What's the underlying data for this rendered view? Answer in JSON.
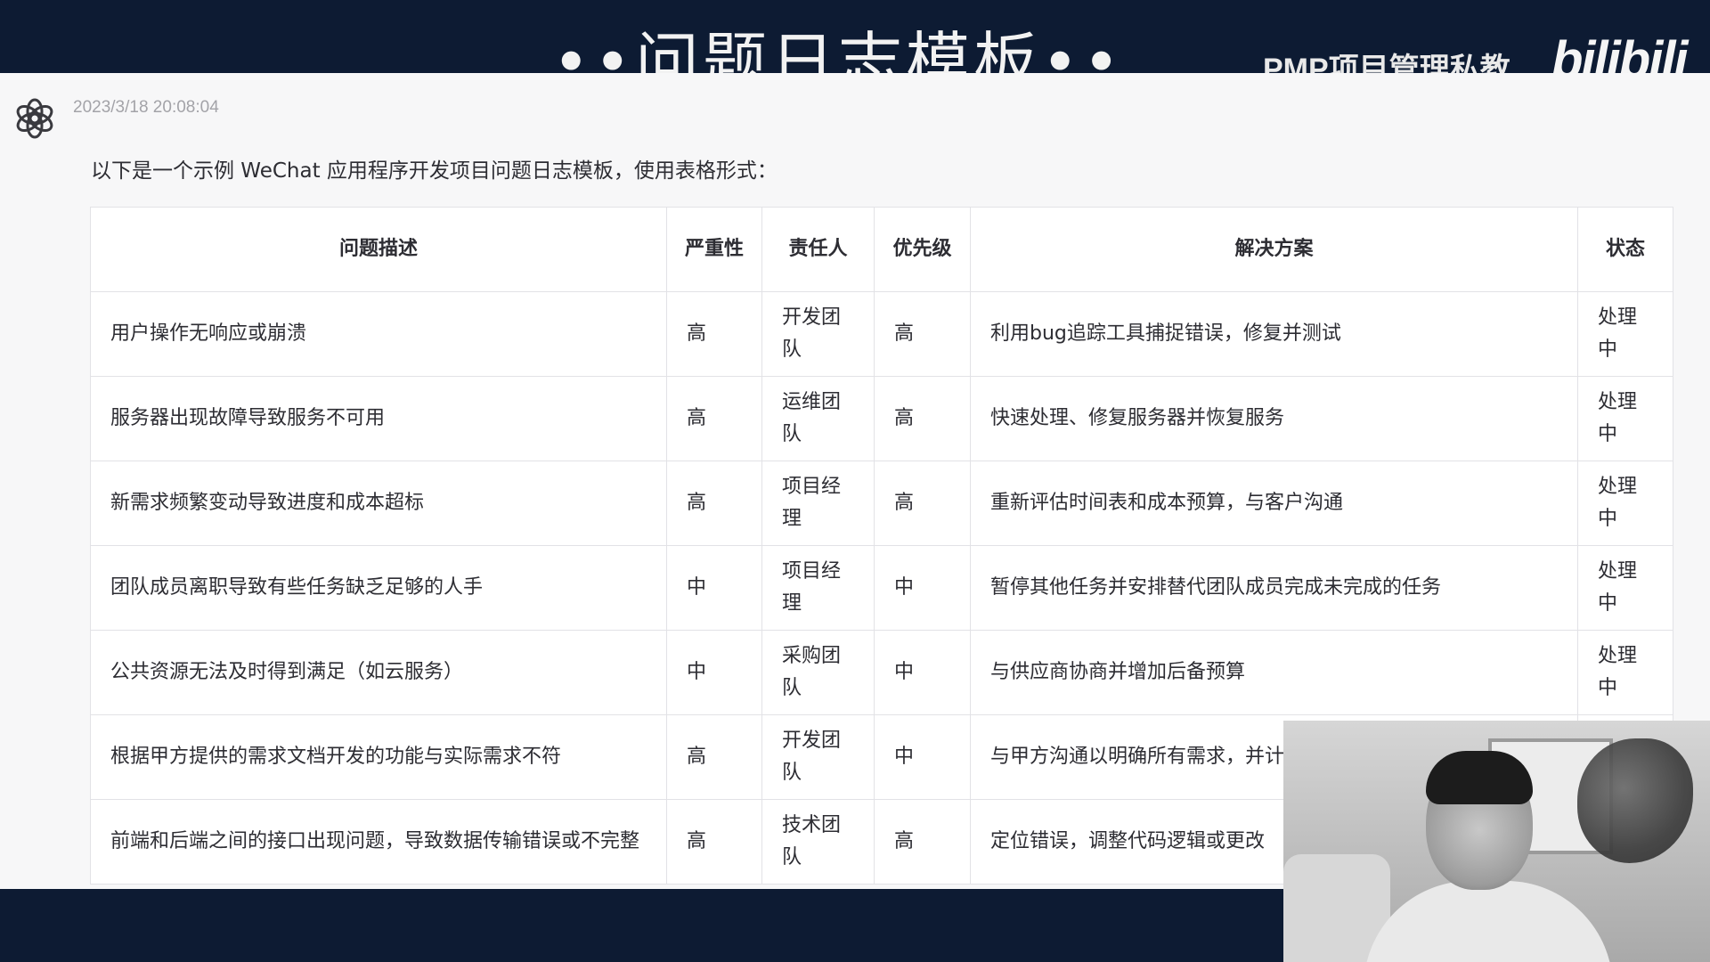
{
  "banner": {
    "title": "••问题日志模板••",
    "brand": "PMP项目管理私教",
    "logo": "bilibili"
  },
  "chat": {
    "timestamp": "2023/3/18 20:08:04",
    "intro": "以下是一个示例 WeChat 应用程序开发项目问题日志模板，使用表格形式：",
    "table": {
      "headers": [
        "问题描述",
        "严重性",
        "责任人",
        "优先级",
        "解决方案",
        "状态"
      ],
      "rows": [
        [
          "用户操作无响应或崩溃",
          "高",
          "开发团队",
          "高",
          "利用bug追踪工具捕捉错误，修复并测试",
          "处理中"
        ],
        [
          "服务器出现故障导致服务不可用",
          "高",
          "运维团队",
          "高",
          "快速处理、修复服务器并恢复服务",
          "处理中"
        ],
        [
          "新需求频繁变动导致进度和成本超标",
          "高",
          "项目经理",
          "高",
          "重新评估时间表和成本预算，与客户沟通",
          "处理中"
        ],
        [
          "团队成员离职导致有些任务缺乏足够的人手",
          "中",
          "项目经理",
          "中",
          "暂停其他任务并安排替代团队成员完成未完成的任务",
          "处理中"
        ],
        [
          "公共资源无法及时得到满足（如云服务）",
          "中",
          "采购团队",
          "中",
          "与供应商协商并增加后备预算",
          "处理中"
        ],
        [
          "根据甲方提供的需求文档开发的功能与实际需求不符",
          "高",
          "开发团队",
          "中",
          "与甲方沟通以明确所有需求，并计划",
          ""
        ],
        [
          "前端和后端之间的接口出现问题，导致数据传输错误或不完整",
          "高",
          "技术团队",
          "高",
          "定位错误，调整代码逻辑或更改",
          ""
        ]
      ]
    }
  },
  "icons": {
    "avatar": "openai-logo-icon"
  },
  "colors": {
    "background": "#0d1b33",
    "panel": "#f7f7f8",
    "table_border": "#e2e2e6",
    "text": "#2d2d33",
    "timestamp": "#a3a3a8"
  }
}
